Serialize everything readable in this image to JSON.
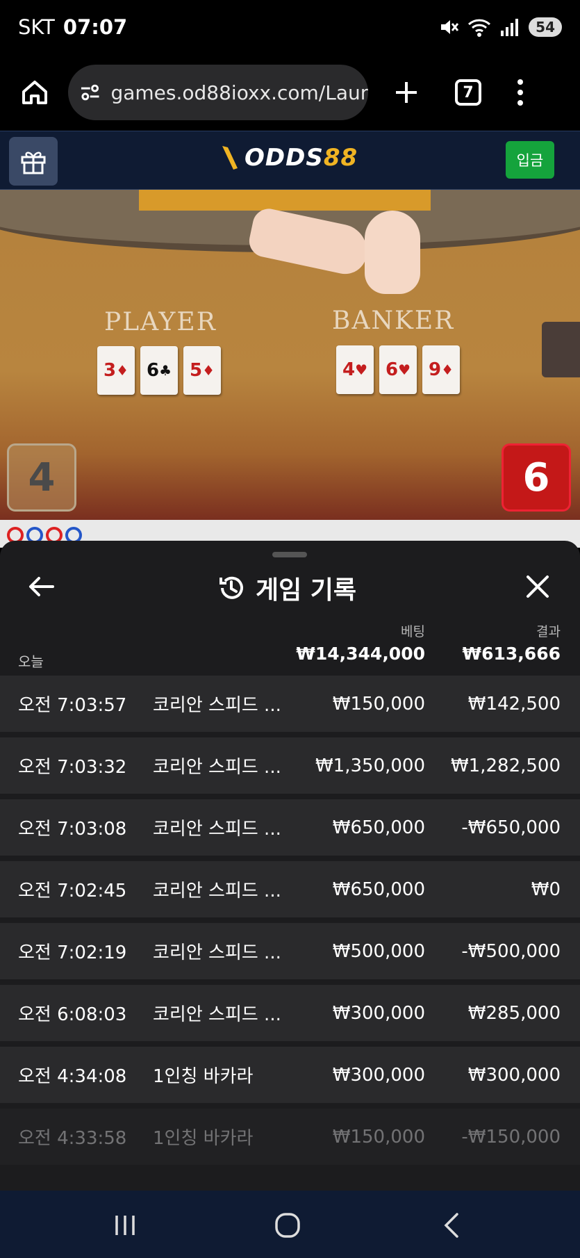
{
  "status_bar": {
    "carrier": "SKT",
    "time": "07:07",
    "battery": "54"
  },
  "browser": {
    "url": "games.od88ioxx.com/Laun",
    "tab_count": "7"
  },
  "site": {
    "logo_main": "ODDS",
    "logo_accent": "88",
    "deposit_label": "입금"
  },
  "game_view": {
    "player_label": "PLAYER",
    "banker_label": "BANKER",
    "player_cards": [
      {
        "rank": "3",
        "suit": "♦",
        "color": "red"
      },
      {
        "rank": "6",
        "suit": "♣",
        "color": "black"
      },
      {
        "rank": "5",
        "suit": "♦",
        "color": "red"
      }
    ],
    "banker_cards": [
      {
        "rank": "4",
        "suit": "♥",
        "color": "red"
      },
      {
        "rank": "6",
        "suit": "♥",
        "color": "red"
      },
      {
        "rank": "9",
        "suit": "♦",
        "color": "red"
      }
    ],
    "player_score": "4",
    "banker_score": "6"
  },
  "history": {
    "title": "게임 기록",
    "bet_header": "베팅",
    "result_header": "결과",
    "today_label": "오늘",
    "total_bet": "₩14,344,000",
    "total_result": "₩613,666",
    "rows": [
      {
        "time": "오전 7:03:57",
        "game": "코리안 스피드 ...",
        "bet": "₩150,000",
        "result": "₩142,500"
      },
      {
        "time": "오전 7:03:32",
        "game": "코리안 스피드 ...",
        "bet": "₩1,350,000",
        "result": "₩1,282,500"
      },
      {
        "time": "오전 7:03:08",
        "game": "코리안 스피드 ...",
        "bet": "₩650,000",
        "result": "-₩650,000"
      },
      {
        "time": "오전 7:02:45",
        "game": "코리안 스피드 ...",
        "bet": "₩650,000",
        "result": "₩0"
      },
      {
        "time": "오전 7:02:19",
        "game": "코리안 스피드 ...",
        "bet": "₩500,000",
        "result": "-₩500,000"
      },
      {
        "time": "오전 6:08:03",
        "game": "코리안 스피드 ...",
        "bet": "₩300,000",
        "result": "₩285,000"
      },
      {
        "time": "오전 4:34:08",
        "game": "1인칭 바카라",
        "bet": "₩300,000",
        "result": "₩300,000"
      },
      {
        "time": "오전 4:33:58",
        "game": "1인칭 바카라",
        "bet": "₩150,000",
        "result": "-₩150,000"
      }
    ]
  },
  "colors": {
    "header_bg": "#0f1b33",
    "deposit_green": "#15a33c",
    "logo_gold": "#f0b423",
    "banker_red": "#c41818",
    "sheet_bg": "#1c1c1e",
    "row_bg": "#2a2a2c"
  }
}
